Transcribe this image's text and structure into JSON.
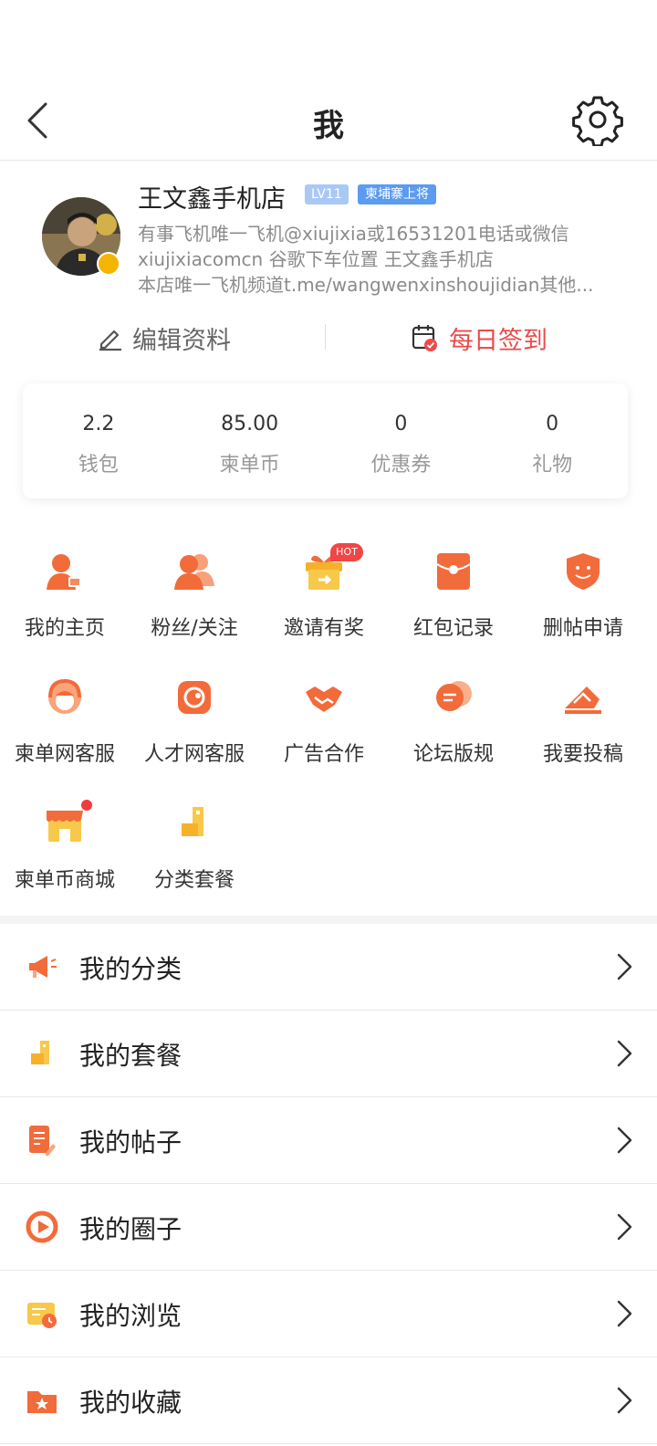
{
  "nav": {
    "title": "我"
  },
  "profile": {
    "name": "王文鑫手机店",
    "level": "LV11",
    "rank": "柬埔寨上将",
    "bio": [
      "有事飞机唯一飞机@xiujixia或16531201电话或微信",
      "xiujixiacomcn 谷歌下车位置 王文鑫手机店",
      "本店唯一飞机频道t.me/wangwenxinshoujidian其他..."
    ]
  },
  "actions": {
    "edit_label": "编辑资料",
    "sign_label": "每日签到"
  },
  "wallet": [
    {
      "value": "2.2",
      "label": "钱包"
    },
    {
      "value": "85.00",
      "label": "柬单币"
    },
    {
      "value": "0",
      "label": "优惠券"
    },
    {
      "value": "0",
      "label": "礼物"
    }
  ],
  "grid": [
    {
      "label": "我的主页",
      "icon": "homepage-icon"
    },
    {
      "label": "粉丝/关注",
      "icon": "fans-icon"
    },
    {
      "label": "邀请有奖",
      "icon": "gift-icon"
    },
    {
      "label": "红包记录",
      "icon": "red-packet-icon"
    },
    {
      "label": "删帖申请",
      "icon": "delete-post-icon"
    },
    {
      "label": "柬单网客服",
      "icon": "customer-service-icon"
    },
    {
      "label": "人才网客服",
      "icon": "talent-service-icon"
    },
    {
      "label": "广告合作",
      "icon": "handshake-icon"
    },
    {
      "label": "论坛版规",
      "icon": "forum-rules-icon"
    },
    {
      "label": "我要投稿",
      "icon": "submit-icon"
    },
    {
      "label": "柬单币商城",
      "icon": "shop-icon"
    },
    {
      "label": "分类套餐",
      "icon": "package-icon"
    }
  ],
  "hot_badge": "HOT",
  "list": [
    {
      "label": "我的分类",
      "icon": "megaphone-icon"
    },
    {
      "label": "我的套餐",
      "icon": "package-icon"
    },
    {
      "label": "我的帖子",
      "icon": "post-icon"
    },
    {
      "label": "我的圈子",
      "icon": "circle-icon"
    },
    {
      "label": "我的浏览",
      "icon": "history-icon"
    },
    {
      "label": "我的收藏",
      "icon": "favorite-folder-icon"
    }
  ],
  "colors": {
    "accent": "#f26b3a",
    "sign_red": "#ec4a4a",
    "rank_blue": "#5b9bf0",
    "level_blue": "#a9c9f5"
  }
}
